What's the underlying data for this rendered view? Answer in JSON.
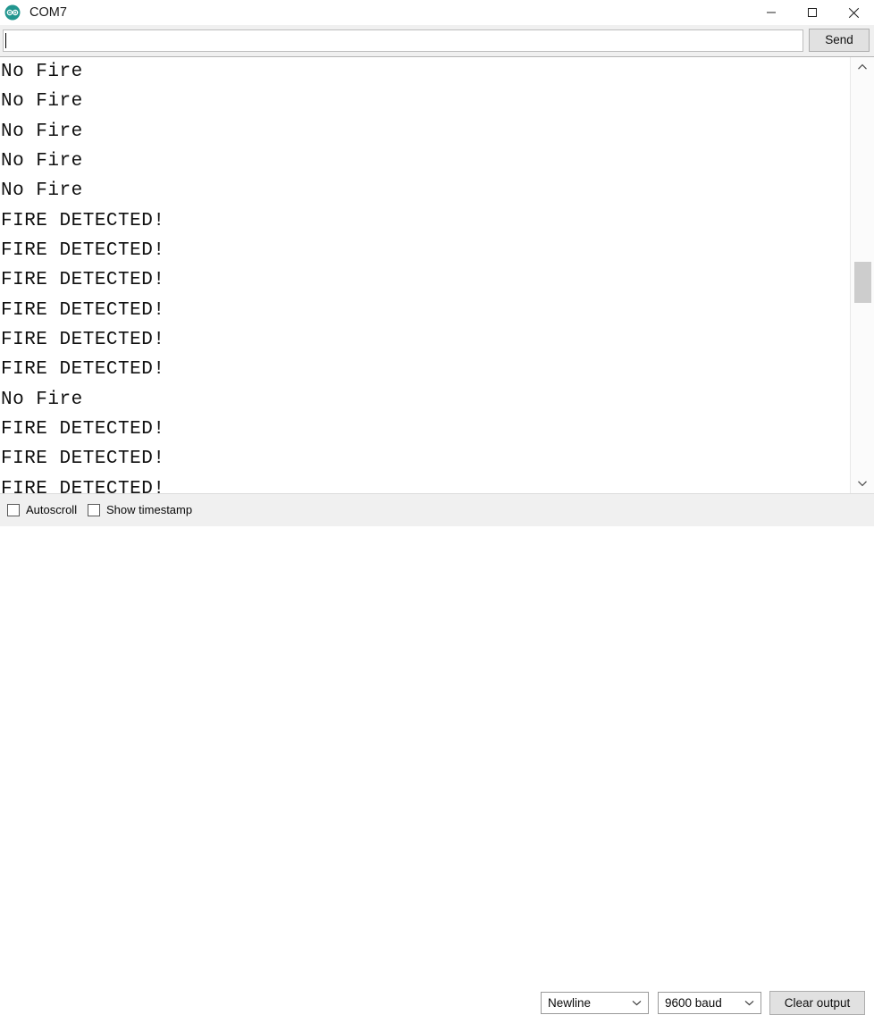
{
  "window": {
    "title": "COM7",
    "app_icon": "arduino-infinity-icon",
    "controls": [
      {
        "name": "minimize",
        "glyph": "minimize-icon"
      },
      {
        "name": "maximize",
        "glyph": "maximize-icon"
      },
      {
        "name": "close",
        "glyph": "close-icon"
      }
    ]
  },
  "send_row": {
    "input_value": "",
    "input_placeholder": "",
    "send_label": "Send"
  },
  "output": {
    "lines": [
      "No Fire",
      "No Fire",
      "No Fire",
      "No Fire",
      "No Fire",
      "FIRE DETECTED!",
      "FIRE DETECTED!",
      "FIRE DETECTED!",
      "FIRE DETECTED!",
      "FIRE DETECTED!",
      "FIRE DETECTED!",
      "No Fire",
      "FIRE DETECTED!",
      "FIRE DETECTED!",
      "FIRE DETECTED!"
    ]
  },
  "scrollbar": {
    "up_arrow_icon": "chevron-up-icon",
    "down_arrow_icon": "chevron-down-icon"
  },
  "bottom_bar": {
    "autoscroll": {
      "label": "Autoscroll",
      "checked": false
    },
    "show_timestamp": {
      "label": "Show timestamp",
      "checked": false
    },
    "line_ending": {
      "selected": "Newline",
      "chevron": "chevron-down-icon"
    },
    "baud_rate": {
      "selected": "9600 baud",
      "chevron": "chevron-down-icon"
    },
    "clear_label": "Clear output"
  },
  "colors": {
    "accent_teal": "#22968f",
    "window_bg": "#ffffff",
    "chrome_bg": "#f0f0f0",
    "text": "#101010",
    "scroll_thumb": "#cdcdcd"
  }
}
